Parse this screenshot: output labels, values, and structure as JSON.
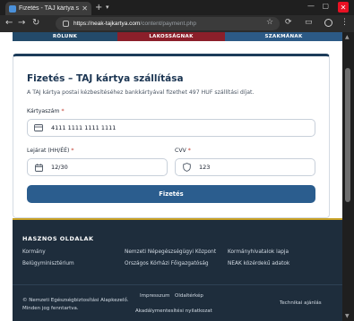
{
  "browser": {
    "tab_title": "Fizetés - TAJ kártya szállí",
    "url_host": "https://neak-tajkartya.com",
    "url_path": "/content/payment.php"
  },
  "nav": {
    "items": [
      "RÓLUNK",
      "LAKOSSÁGNAK",
      "SZAKMÁNAK"
    ]
  },
  "payment": {
    "title": "Fizetés – TAJ kártya szállítása",
    "description": "A TAJ kártya postai kézbesítéséhez bankkártyával fizethet 497 HUF szállítási díjat.",
    "card_number_label": "Kártyaszám",
    "card_number_value": "4111 1111 1111 1111",
    "expiry_label": "Lejárat (HH/ÉÉ)",
    "expiry_value": "12/30",
    "cvv_label": "CVV",
    "cvv_value": "123",
    "required_mark": "*",
    "submit_label": "Fizetés"
  },
  "footer": {
    "heading": "HASZNOS OLDALAK",
    "links": [
      "Kormány",
      "Nemzeti Népegészségügyi Központ",
      "Kormányhivatalok lapja",
      "Belügyminisztérium",
      "Országos Kórházi Főigazgatóság",
      "NEAK közérdekű adatok"
    ],
    "copyright": "© Nemzeti Egészségbiztosítási Alapkezelő. Minden jog fenntartva.",
    "impressum": "Impresszum",
    "sitemap": "Oldaltérkép",
    "accessibility": "Akadálymentesítési nyilatkozat",
    "tech_help": "Technikai ajánlás"
  },
  "colors": {
    "primary": "#2b5d8e",
    "nav_red": "#8b1f2a",
    "footer_bg": "#1e2d3c",
    "footer_accent": "#c9a227"
  }
}
